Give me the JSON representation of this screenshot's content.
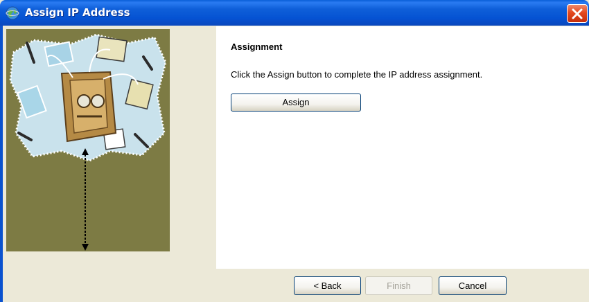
{
  "window": {
    "title": "Assign IP Address",
    "icon": "globe-network-icon",
    "close_icon": "close-icon"
  },
  "side_panel": {
    "illustration": "network-illustration",
    "background_color": "#7d7b44"
  },
  "main": {
    "heading": "Assignment",
    "instruction": "Click the Assign button to complete the IP address assignment.",
    "assign_label": "Assign"
  },
  "footer": {
    "back_label": "< Back",
    "finish_label": "Finish",
    "cancel_label": "Cancel"
  },
  "colors": {
    "titlebar": "#0553d3",
    "close": "#e4491f",
    "window_bg": "#ece9d8",
    "content_bg": "#ffffff"
  }
}
